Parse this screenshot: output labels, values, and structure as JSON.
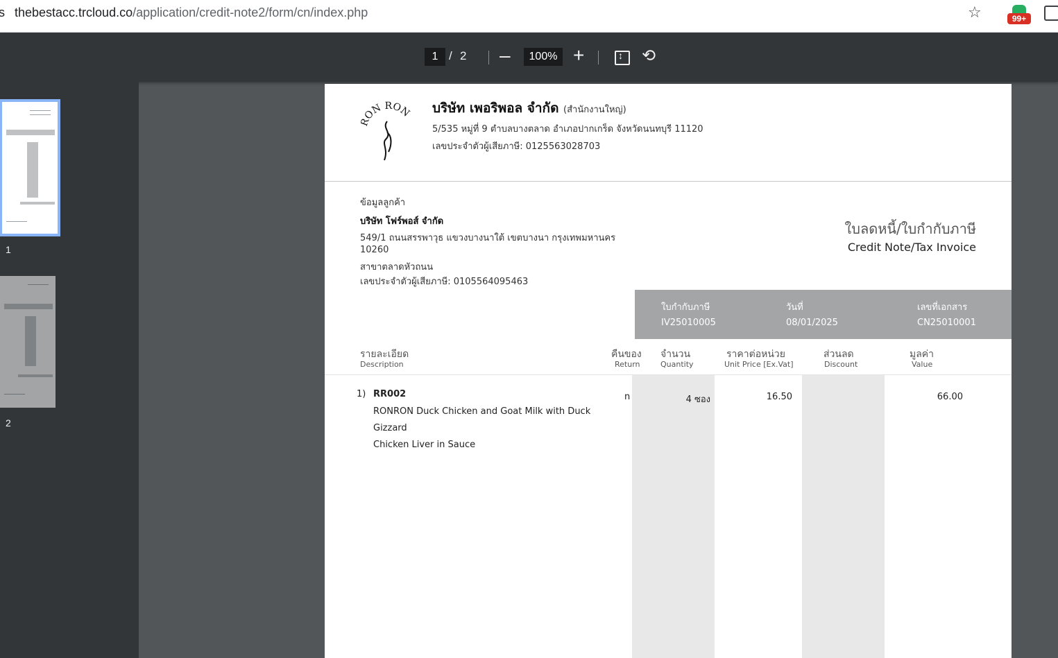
{
  "browser": {
    "url_prefix": "s",
    "url_domain": "thebestacc.trcloud.co",
    "url_path": "/application/credit-note2/form/cn/index.php",
    "extension_badge": "99+"
  },
  "toolbar": {
    "current_page": "1",
    "page_separator": "/",
    "total_pages": "2",
    "zoom": "100%",
    "zoom_out_label": "–",
    "zoom_in_label": "+",
    "icons": [
      "zoom-out-icon",
      "zoom-in-icon",
      "fit-page-icon",
      "rotate-icon"
    ]
  },
  "sidebar": {
    "thumbnails": [
      {
        "label": "1",
        "selected": true
      },
      {
        "label": "2",
        "selected": false
      }
    ]
  },
  "document": {
    "logo_text": "RON RON",
    "company": {
      "name": "บริษัท เพอริพอล จำกัด",
      "branch": "(สำนักงานใหญ่)",
      "address": "5/535 หมู่ที่ 9 ตำบลบางตลาด อำเภอปากเกร็ด จังหวัดนนทบุรี 11120",
      "tax_id": "เลขประจำตัวผู้เสียภาษี: 0125563028703"
    },
    "customer": {
      "label": "ข้อมูลลูกค้า",
      "name": "บริษัท โฟร์พอส์ จำกัด",
      "address_line1": "549/1 ถนนสรรพาวุธ แขวงบางนาใต้ เขตบางนา กรุงเทพมหานคร",
      "address_line2": "10260",
      "branch": "สาขาตลาดหัวถนน",
      "tax_id": "เลขประจำตัวผู้เสียภาษี: 0105564095463"
    },
    "title_th": "ใบลดหนี้/ใบกำกับภาษี",
    "title_en": "Credit Note/Tax Invoice",
    "info": {
      "invoice_label": "ใบกำกับภาษี",
      "invoice_value": "IV25010005",
      "date_label": "วันที่",
      "date_value": "08/01/2025",
      "doc_no_label": "เลขที่เอกสาร",
      "doc_no_value": "CN25010001"
    },
    "columns": [
      {
        "th": "รายละเอียด",
        "en": "Description"
      },
      {
        "th": "คืนของ",
        "en": "Return"
      },
      {
        "th": "จำนวน",
        "en": "Quantity"
      },
      {
        "th": "ราคาต่อหน่วย",
        "en": "Unit Price [Ex.Vat]"
      },
      {
        "th": "ส่วนลด",
        "en": "Discount"
      },
      {
        "th": "มูลค่า",
        "en": "Value"
      }
    ],
    "items": [
      {
        "index": "1)",
        "code": "RR002",
        "description_line1": "RONRON Duck Chicken and Goat Milk with Duck Gizzard",
        "description_line2": "Chicken Liver in Sauce",
        "return": "n",
        "quantity": "4 ซอง",
        "unit_price": "16.50",
        "discount": "",
        "value": "66.00"
      }
    ]
  }
}
